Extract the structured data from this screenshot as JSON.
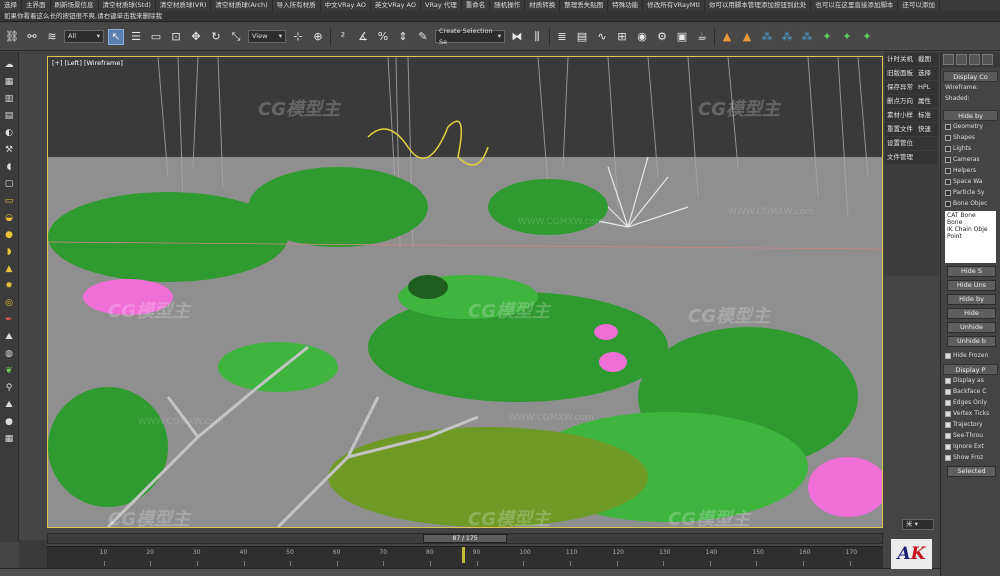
{
  "menu": {
    "row1": [
      "选择",
      "主界面",
      "刷新场景信息",
      "清空材质球(Std)",
      "清空材质球(VR)",
      "清空材质球(Arch)",
      "导入所有材质",
      "中文VRay AO",
      "英文VRay AO",
      "VRay 代理",
      "重命名",
      "随机操作",
      "材质转换",
      "整理丢失贴图",
      "特殊功能",
      "修改所有VRayMtl",
      "你可以用脚本管理添加按钮到此处",
      "也可以在这里直接添加脚本",
      "还可以添加"
    ],
    "row2": [
      "如果你看着这么长的按钮很不爽,请右键单击我来删除我"
    ]
  },
  "toolbar": {
    "filter_value": "All",
    "coord_value": "View",
    "selection_set_placeholder": "Create Selection Se"
  },
  "viewport": {
    "label": "[+] [Left] [Wireframe]",
    "watermark": "CG模型主",
    "watermark_url": "WWW.CGMXW.com"
  },
  "cmd_col": [
    "计时关机",
    "旧版面板",
    "保存异常",
    "删点万向",
    "素材小样",
    "重置文件",
    "设置管位",
    "文件管理"
  ],
  "cmd_col_right": [
    "截图",
    "选择",
    "HPL",
    "属性",
    "标准",
    "快速"
  ],
  "cmd_panel": {
    "display_color": "Display Co",
    "wireframe_label": "Wireframe:",
    "shaded_label": "Shaded:",
    "hide_by_category": "Hide by",
    "categories": [
      {
        "label": "Geometry",
        "on": false
      },
      {
        "label": "Shapes",
        "on": false
      },
      {
        "label": "Lights",
        "on": false
      },
      {
        "label": "Cameras",
        "on": false
      },
      {
        "label": "Helpers",
        "on": false
      },
      {
        "label": "Space Wa",
        "on": false
      },
      {
        "label": "Particle Sy",
        "on": false
      },
      {
        "label": "Bone Objec",
        "on": false
      }
    ],
    "list_items": [
      "CAT Bone",
      "Bone",
      "IK Chain Obje",
      "Point"
    ],
    "buttons": [
      "Hide S",
      "Hide Uns",
      "Hide by",
      "Hide",
      "Unhide",
      "Unhide b"
    ],
    "hide_frozen": "Hide Frozen",
    "display_props": "Display P",
    "props": [
      "Display as",
      "Backface C",
      "Edges Only",
      "Vertex Ticks",
      "Trajectory",
      "See-Throu",
      "Ignore Ext",
      "Show Froz"
    ],
    "selected": "Selected"
  },
  "timeline": {
    "frame_readout": "87 / 175",
    "current_frame": 87,
    "total_frames": 175,
    "ticks": [
      10,
      20,
      30,
      40,
      50,
      60,
      70,
      80,
      90,
      100,
      110,
      120,
      130,
      140,
      150,
      160,
      170
    ]
  },
  "logo": {
    "a": "A",
    "k": "K"
  },
  "units_dropdown": "米"
}
